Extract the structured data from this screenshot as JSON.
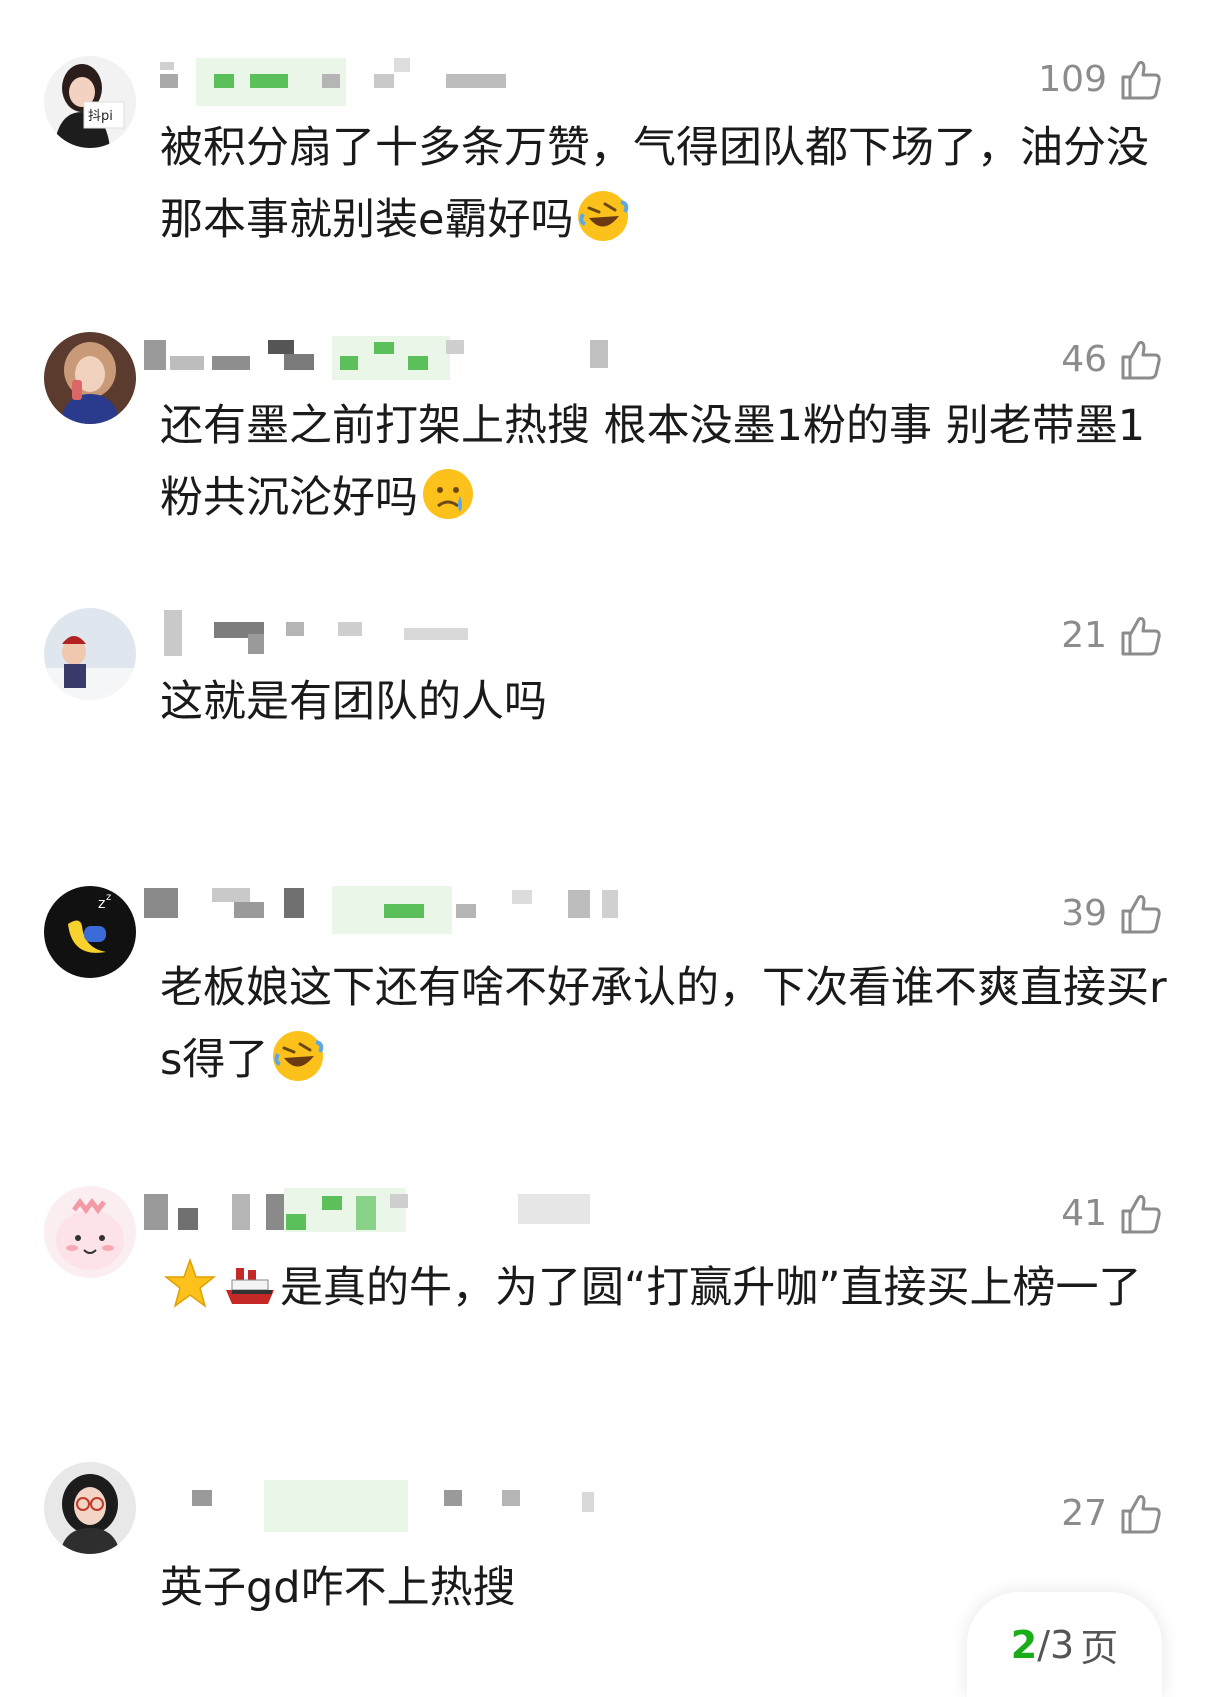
{
  "colors": {
    "accent": "#1aad19",
    "muted": "#8c8c8c",
    "text": "#1a1a1a"
  },
  "comments": [
    {
      "likes": "109",
      "text_a": "被积分扇了十多条万赞，气得团队都下场了，油分没那本事就别装e霸好吗",
      "emoji_a": "rolling-on-floor-laughing",
      "avatar_icon": "avatar-woman-sign"
    },
    {
      "likes": "46",
      "text_a": "还有墨之前打架上热搜 根本没墨1粉的事 别老带墨1粉共沉沦好吗",
      "emoji_a": "sad-but-relieved-face",
      "avatar_icon": "avatar-woman-phone"
    },
    {
      "likes": "21",
      "text_a": "这就是有团队的人吗",
      "avatar_icon": "avatar-child-snow"
    },
    {
      "likes": "39",
      "text_a": "老板娘这下还有啥不好承认的，下次看谁不爽直接买rs得了",
      "emoji_a": "rolling-on-floor-laughing",
      "avatar_icon": "avatar-sleeping-moon"
    },
    {
      "likes": "41",
      "text_b": "是真的牛，为了圆“打赢升咖”直接买上榜一了",
      "emoji_star": "star",
      "emoji_ship": "ship",
      "avatar_icon": "avatar-pink-dino"
    },
    {
      "likes": "27",
      "text_a": "英子gd咋不上热搜",
      "avatar_icon": "avatar-woman-glasses"
    }
  ],
  "pager": {
    "current": "2",
    "separator": "/",
    "total": "3",
    "unit": "页"
  }
}
